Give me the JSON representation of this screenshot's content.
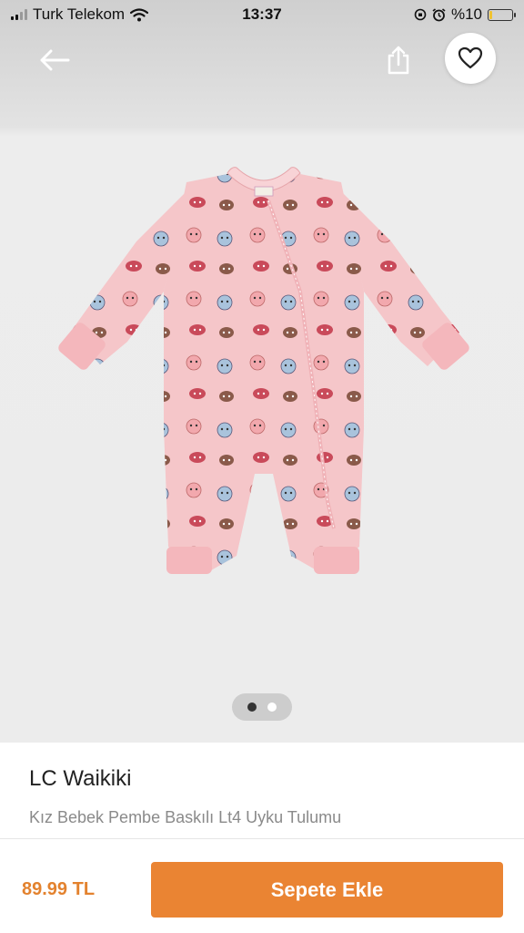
{
  "status_bar": {
    "carrier": "Turk Telekom",
    "time": "13:37",
    "battery_text": "%10",
    "battery_level": 0.1,
    "icons": [
      "signal-icon",
      "wifi-icon",
      "orientation-lock-icon",
      "alarm-icon",
      "battery-icon"
    ]
  },
  "hero": {
    "image_count": 2,
    "active_image_index": 0,
    "product_image_icon": "pink-baby-sleepsuit-with-animal-print"
  },
  "toolbar": {
    "back_icon": "back-arrow-icon",
    "share_icon": "share-icon",
    "favorite_icon": "heart-icon"
  },
  "product": {
    "brand": "LC Waikiki",
    "name": "Kız Bebek Pembe Baskılı Lt4 Uyku Tulumu",
    "price": "89.99 TL"
  },
  "cart": {
    "button_label": "Sepete Ekle"
  },
  "colors": {
    "accent": "#ea8433",
    "price": "#e3822e",
    "garment": "#f5c6c9"
  }
}
